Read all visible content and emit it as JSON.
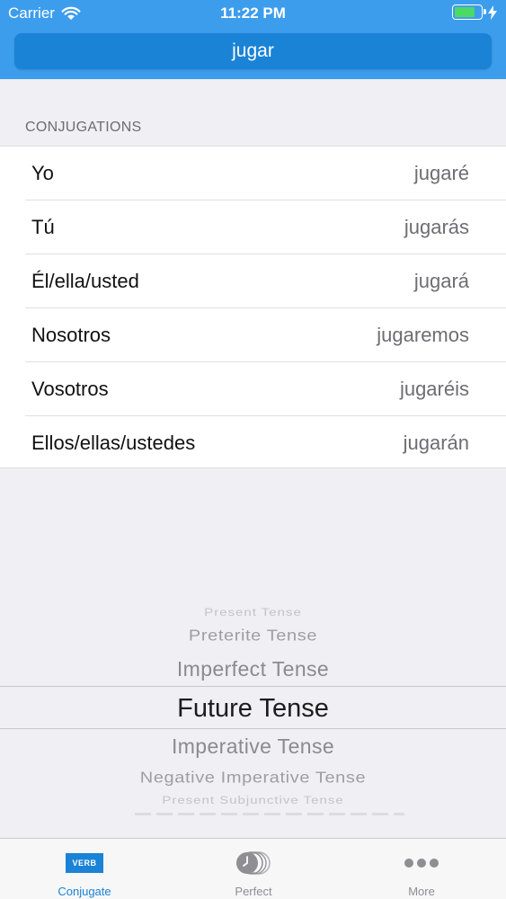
{
  "status_bar": {
    "carrier": "Carrier",
    "time": "11:22 PM"
  },
  "search": {
    "verb": "jugar"
  },
  "conjugations": {
    "header": "CONJUGATIONS",
    "rows": [
      {
        "pronoun": "Yo",
        "form": "jugaré"
      },
      {
        "pronoun": "Tú",
        "form": "jugarás"
      },
      {
        "pronoun": "Él/ella/usted",
        "form": "jugará"
      },
      {
        "pronoun": "Nosotros",
        "form": "jugaremos"
      },
      {
        "pronoun": "Vosotros",
        "form": "jugaréis"
      },
      {
        "pronoun": "Ellos/ellas/ustedes",
        "form": "jugarán"
      }
    ]
  },
  "tense_picker": {
    "options": [
      "Present Tense",
      "Preterite Tense",
      "Imperfect Tense",
      "Future Tense",
      "Imperative Tense",
      "Negative Imperative Tense",
      "Present Subjunctive Tense"
    ],
    "selected": "Future Tense"
  },
  "tabbar": {
    "tabs": [
      {
        "label": "Conjugate",
        "icon": "verb-icon",
        "icon_text": "VERB",
        "active": true
      },
      {
        "label": "Perfect",
        "icon": "clock-stack-icon",
        "active": false
      },
      {
        "label": "More",
        "icon": "more-dots-icon",
        "active": false
      }
    ]
  },
  "colors": {
    "header": "#3d9ded",
    "accent": "#1a83d6",
    "battery": "#4cd964"
  }
}
